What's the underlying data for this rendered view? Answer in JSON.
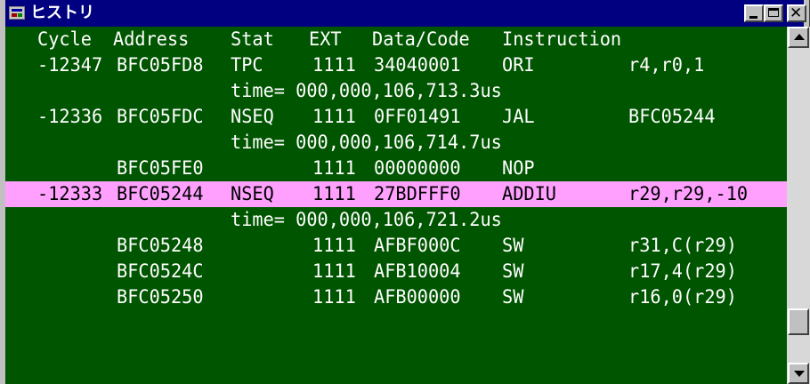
{
  "window": {
    "title": "ヒストリ"
  },
  "icons": {
    "app": "history-app-icon",
    "minimize": "minimize-icon",
    "maximize": "maximize-icon",
    "close": "close-icon",
    "scroll_up": "scroll-up-arrow-icon",
    "scroll_down": "scroll-down-arrow-icon"
  },
  "titlebar_buttons": {
    "close": "✕"
  },
  "colors": {
    "background": "#005500",
    "text": "#ffffff",
    "highlight": "#ffa0ff",
    "titlebar": "#000080"
  },
  "header": {
    "cycle": "Cycle",
    "address": "Address",
    "stat": "Stat",
    "ext": "EXT",
    "data": "Data/Code",
    "instruction": "Instruction"
  },
  "rows": [
    {
      "cycle": "-12347",
      "address": "BFC05FD8",
      "stat": "TPC",
      "ext": "1111",
      "data": "34040001",
      "mnemonic": "ORI",
      "operands": "r4,r0,1"
    },
    {
      "time": "time= 000,000,106,713.3us"
    },
    {
      "cycle": "-12336",
      "address": "BFC05FDC",
      "stat": "NSEQ",
      "ext": "1111",
      "data": "0FF01491",
      "mnemonic": "JAL",
      "operands": "BFC05244"
    },
    {
      "time": "time= 000,000,106,714.7us"
    },
    {
      "cycle": "",
      "address": "BFC05FE0",
      "stat": "",
      "ext": "1111",
      "data": "00000000",
      "mnemonic": "NOP",
      "operands": ""
    },
    {
      "cycle": "-12333",
      "address": "BFC05244",
      "stat": "NSEQ",
      "ext": "1111",
      "data": "27BDFFF0",
      "mnemonic": "ADDIU",
      "operands": "r29,r29,-10",
      "selected": true
    },
    {
      "time": "time= 000,000,106,721.2us"
    },
    {
      "cycle": "",
      "address": "BFC05248",
      "stat": "",
      "ext": "1111",
      "data": "AFBF000C",
      "mnemonic": "SW",
      "operands": "r31,C(r29)"
    },
    {
      "cycle": "",
      "address": "BFC0524C",
      "stat": "",
      "ext": "1111",
      "data": "AFB10004",
      "mnemonic": "SW",
      "operands": "r17,4(r29)"
    },
    {
      "cycle": "",
      "address": "BFC05250",
      "stat": "",
      "ext": "1111",
      "data": "AFB00000",
      "mnemonic": "SW",
      "operands": "r16,0(r29)"
    }
  ]
}
